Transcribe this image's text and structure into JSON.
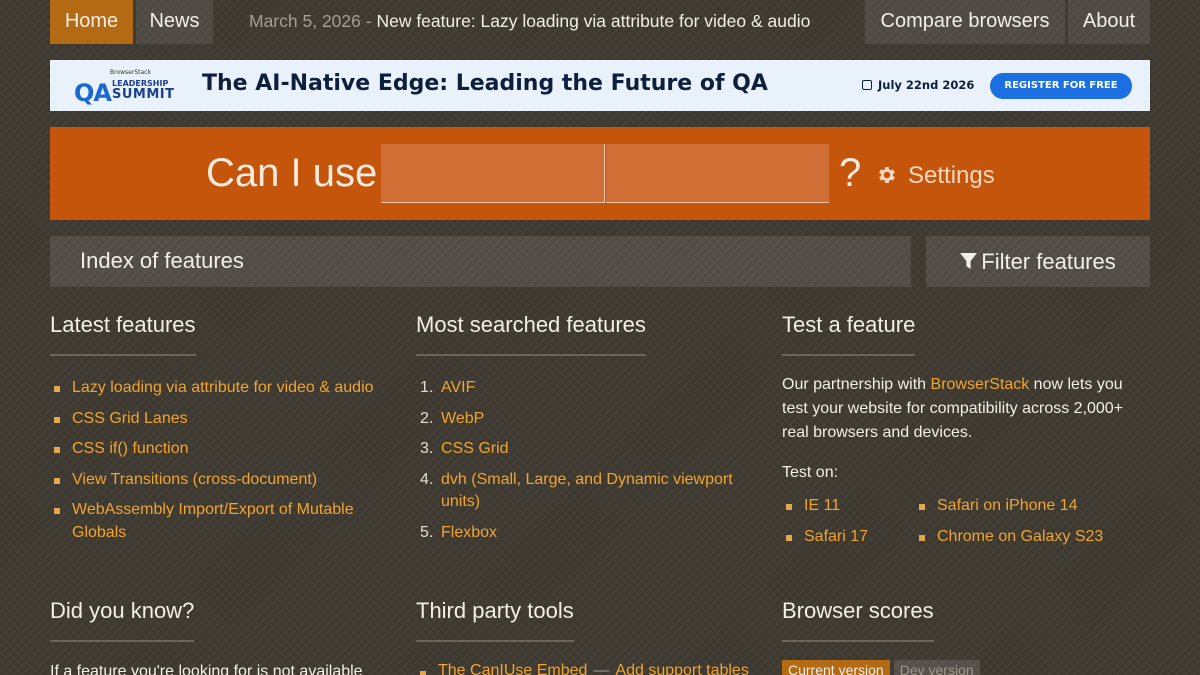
{
  "nav": {
    "home": "Home",
    "news": "News",
    "news_date": "March 5, 2026",
    "news_separator": "-",
    "news_title": "New feature: Lazy loading via attribute for video & audio",
    "compare": "Compare browsers",
    "about": "About"
  },
  "banner": {
    "logo_small": "BrowserStack",
    "logo_qa": "QA",
    "logo_leadership": "LEADERSHIP",
    "logo_summit": "SUMMIT",
    "title": "The AI-Native Edge: Leading the Future of QA",
    "date": "July 22nd 2026",
    "cta": "REGISTER FOR FREE",
    "colors": {
      "background": "#e9f2fb",
      "cta": "#1c6fe0",
      "text": "#0e1f3d"
    }
  },
  "search": {
    "prefix": "Can I use",
    "suffix": "?",
    "settings": "Settings",
    "field_a_value": "",
    "field_b_value": ""
  },
  "index": {
    "title": "Index of features",
    "filter": "Filter features"
  },
  "latest": {
    "title": "Latest features",
    "items": [
      "Lazy loading via attribute for video & audio",
      "CSS Grid Lanes",
      "CSS if() function",
      "View Transitions (cross-document)",
      "WebAssembly Import/Export of Mutable Globals"
    ]
  },
  "most_searched": {
    "title": "Most searched features",
    "items": [
      {
        "num": "1.",
        "label": "AVIF"
      },
      {
        "num": "2.",
        "label": "WebP"
      },
      {
        "num": "3.",
        "label": "CSS Grid"
      },
      {
        "num": "4.",
        "label": "dvh (Small, Large, and Dynamic viewport units)"
      },
      {
        "num": "5.",
        "label": "Flexbox"
      }
    ]
  },
  "test": {
    "title": "Test a feature",
    "text_before": "Our partnership with",
    "partner_link": "BrowserStack",
    "text_after": "now lets you test your website for compatibility across 2,000+ real browsers and devices.",
    "test_on": "Test on:",
    "browsers_left": [
      "IE 11",
      "Safari 17"
    ],
    "browsers_right": [
      "Safari on iPhone 14",
      "Chrome on Galaxy S23"
    ]
  },
  "did_you_know": {
    "title": "Did you know?",
    "text": "If a feature you're looking for is not available"
  },
  "third_party": {
    "title": "Third party tools",
    "link1": "The CanIUse Embed",
    "separator": "—",
    "link2": "Add support tables"
  },
  "scores": {
    "title": "Browser scores",
    "tab_current": "Current version",
    "tab_dev": "Dev version"
  },
  "colors": {
    "accent_orange": "#c4550b",
    "home_active": "#b46a12",
    "link": "#f0a431"
  }
}
